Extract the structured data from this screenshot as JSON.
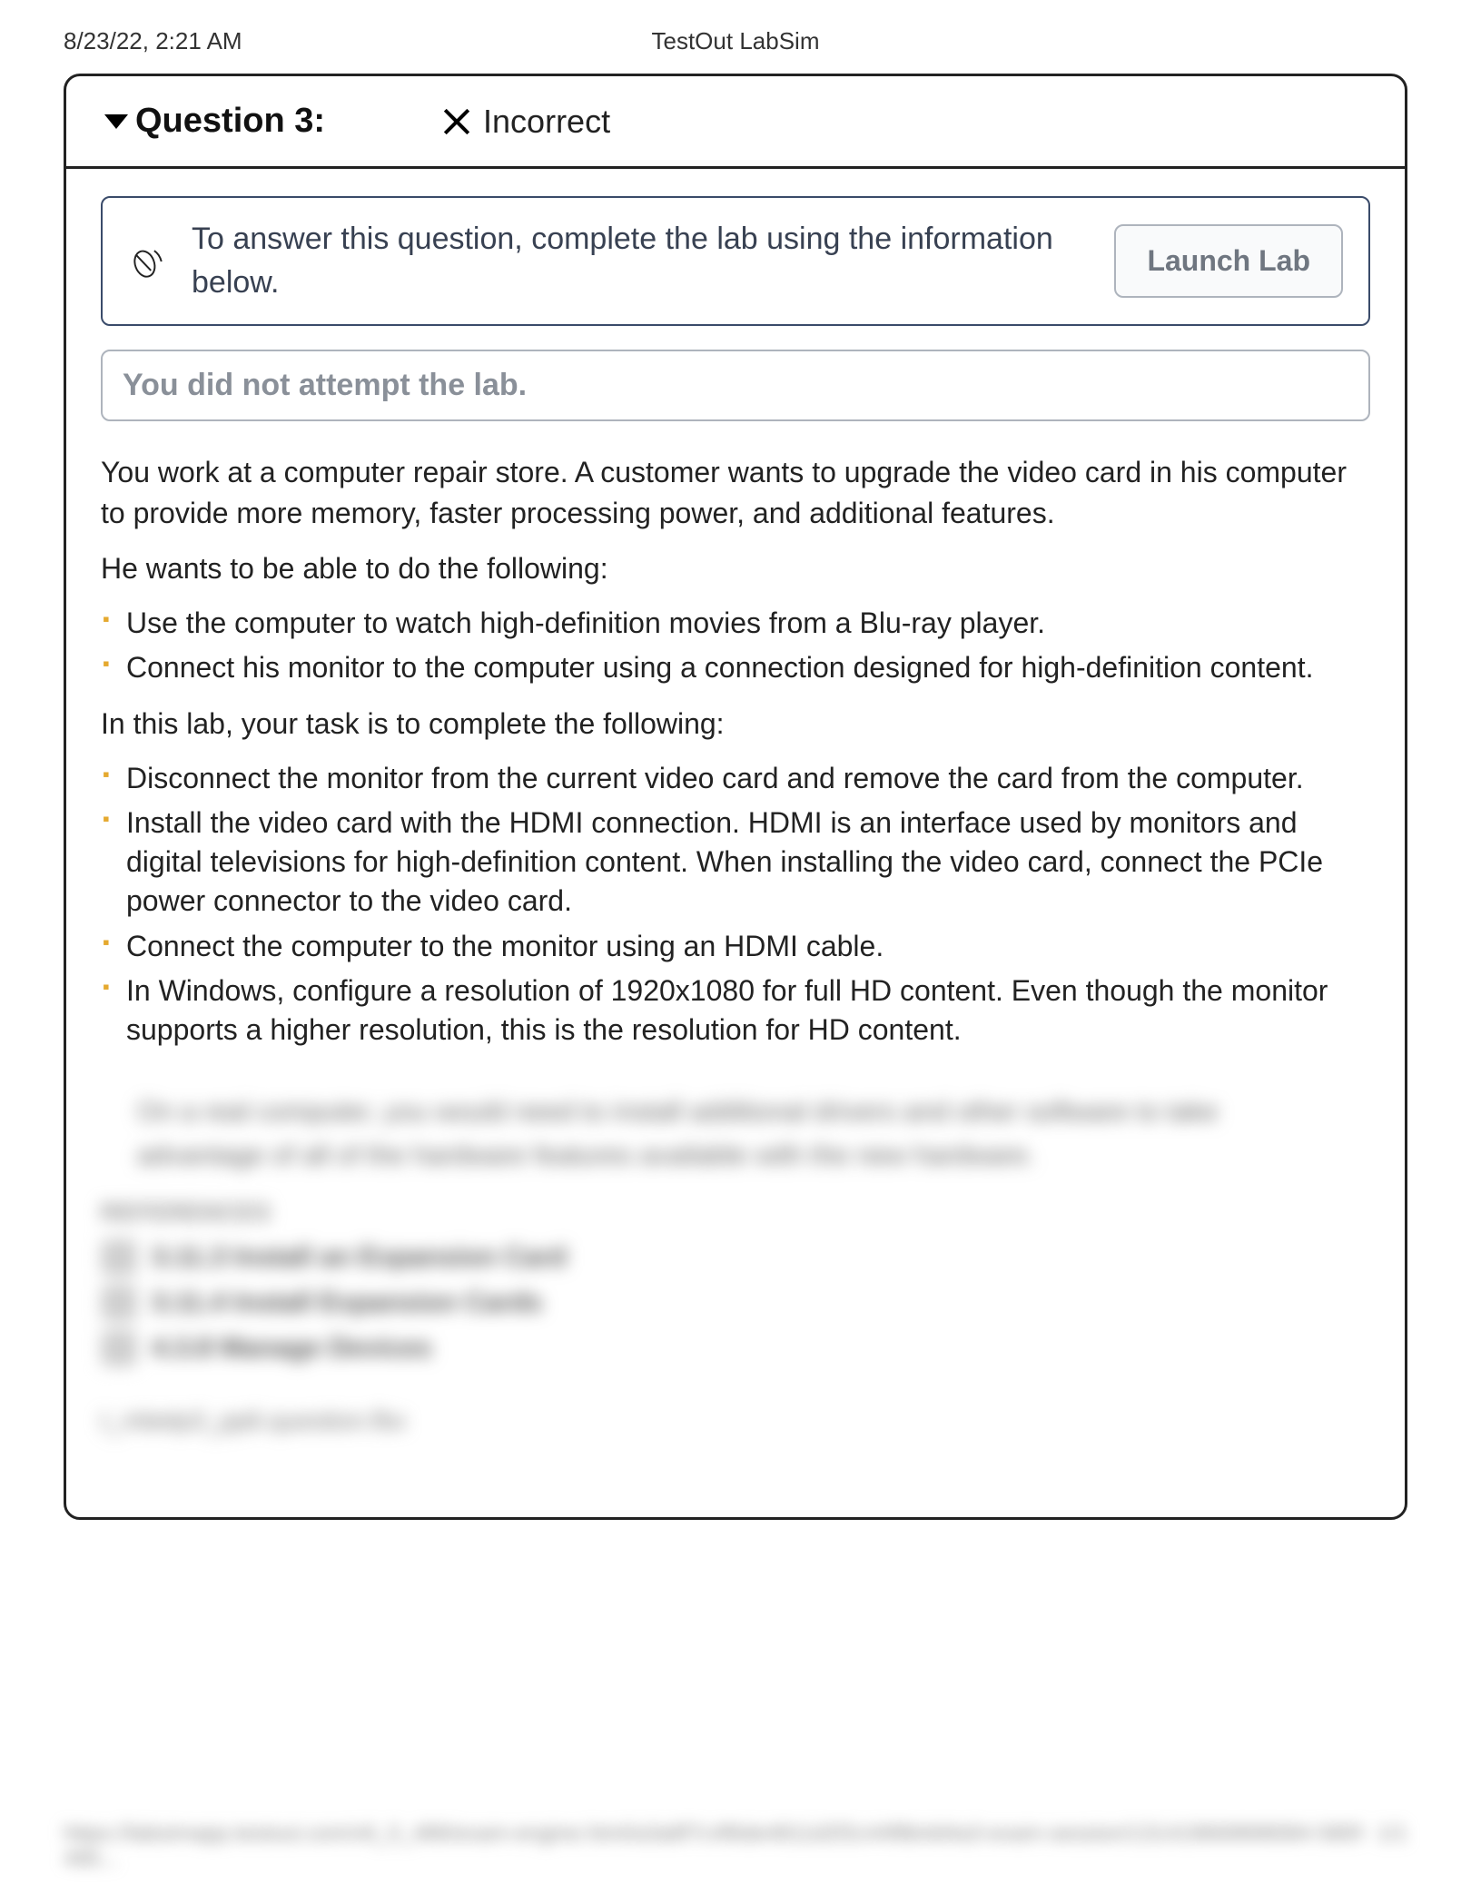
{
  "meta": {
    "timestamp": "8/23/22, 2:21 AM",
    "app_title": "TestOut LabSim"
  },
  "question": {
    "title_label": "Question 3:",
    "status_label": "Incorrect",
    "info_text": "To answer this question, complete the lab using the information below.",
    "launch_label": "Launch Lab",
    "warn_text": "You did not attempt the lab.",
    "paragraphs": {
      "intro": "You work at a computer repair store. A customer wants to upgrade the video card in his computer to provide more memory, faster processing power, and additional features.",
      "wants": "He wants to be able to do the following:",
      "task_intro": "In this lab, your task is to complete the following:"
    },
    "wants_bullets": [
      "Use the computer to watch high-definition movies from a Blu-ray player.",
      "Connect his monitor to the computer using a connection designed for high-definition content."
    ],
    "task_bullets": [
      "Disconnect the monitor from the current video card and remove the card from the computer.",
      "Install the video card with the HDMI connection. HDMI is an interface used by monitors and digital televisions for high-definition content. When installing the video card, connect the PCIe power connector to the video card.",
      "Connect the computer to the monitor using an HDMI cable.",
      "In Windows, configure a resolution of 1920x1080 for full HD content. Even though the monitor supports a higher resolution, this is the resolution for HD content."
    ]
  },
  "blurred": {
    "note_line1": "On a real computer, you would need to install additional drivers and other software to take",
    "note_line2": "advantage of all of the hardware features available with the new hardware.",
    "refs_title": "REFERENCES",
    "refs": [
      "3.11.3 Install an Expansion Card",
      "3.11.4 Install Expansion Cards",
      "4.3.8 Manage Devices"
    ],
    "file": "t_mbelp3_pp6.question.fbx"
  },
  "footer": {
    "left": "https://labsimapp.testout.com/v6_0_486/exam-engine.html/a3a8f7c4f6de4811d2f2c44f8b4d4a3-exam-session/131419669898084-580f-490...",
    "right": "1/1"
  },
  "icons": {
    "mouse": "mouse-icon",
    "close": "close-icon",
    "caret": "caret-down-icon"
  }
}
